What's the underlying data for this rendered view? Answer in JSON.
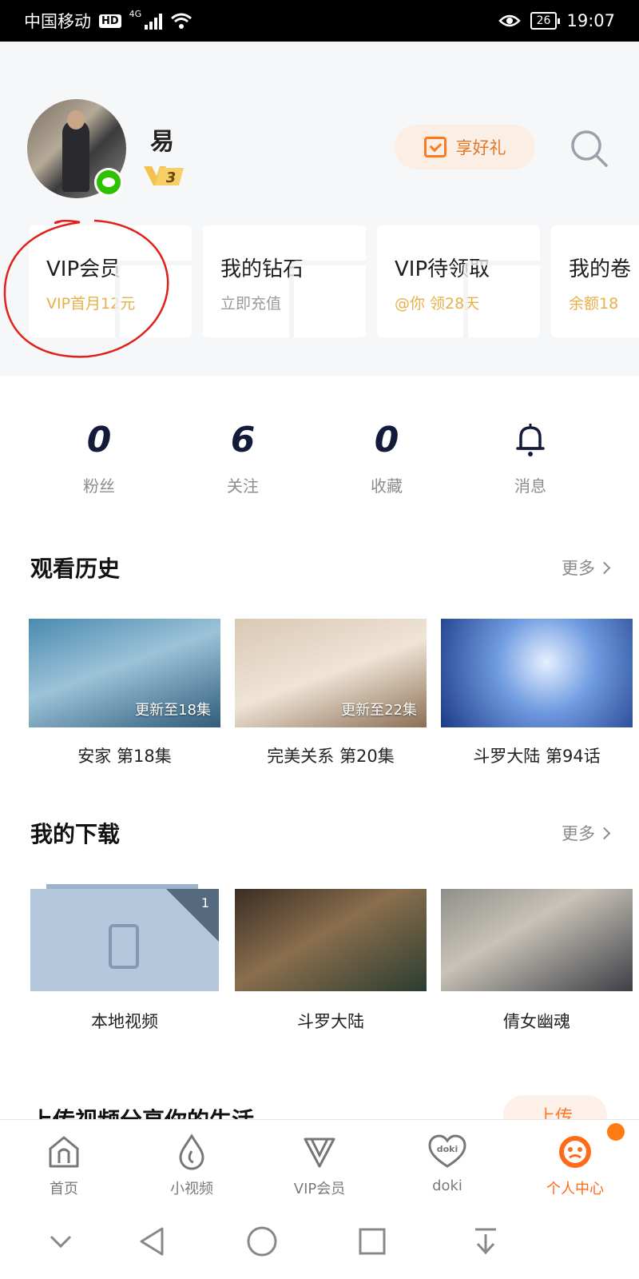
{
  "status_bar": {
    "carrier": "中国移动",
    "hd": "HD",
    "network": "4G",
    "battery": "26",
    "time": "19:07"
  },
  "profile": {
    "username": "易",
    "vip_level": "3",
    "gift_label": "享好礼"
  },
  "cards": [
    {
      "title": "VIP会员",
      "subtitle": "VIP首月12元",
      "subtitle_color": "#e8b04a"
    },
    {
      "title": "我的钻石",
      "subtitle": "立即充值",
      "subtitle_color": "#9a9a9a"
    },
    {
      "title": "VIP待领取",
      "subtitle": "@你 领28天",
      "subtitle_color": "#e8b04a"
    },
    {
      "title": "我的卷",
      "subtitle": "余额18",
      "subtitle_color": "#e8b04a"
    }
  ],
  "stats": [
    {
      "value": "0",
      "label": "粉丝"
    },
    {
      "value": "6",
      "label": "关注"
    },
    {
      "value": "0",
      "label": "收藏"
    },
    {
      "label": "消息",
      "icon": "bell-icon"
    }
  ],
  "history": {
    "title": "观看历史",
    "more": "更多",
    "items": [
      {
        "caption": "安家 第18集",
        "update": "更新至18集"
      },
      {
        "caption": "完美关系 第20集",
        "update": "更新至22集"
      },
      {
        "caption": "斗罗大陆 第94话",
        "update": ""
      }
    ]
  },
  "downloads": {
    "title": "我的下载",
    "more": "更多",
    "items": [
      {
        "caption": "本地视频",
        "count": "1"
      },
      {
        "caption": "斗罗大陆"
      },
      {
        "caption": "倩女幽魂"
      }
    ]
  },
  "promo": {
    "text": "上传视频分享你的生活",
    "button": "上传"
  },
  "bottom_nav": [
    {
      "label": "首页",
      "icon": "home-icon"
    },
    {
      "label": "小视频",
      "icon": "drop-icon"
    },
    {
      "label": "VIP会员",
      "icon": "vip-icon"
    },
    {
      "label": "doki",
      "icon": "doki-heart-icon"
    },
    {
      "label": "个人中心",
      "icon": "profile-face-icon",
      "active": true
    }
  ],
  "colors": {
    "accent": "#ff6a1a",
    "vip_gold": "#e8b04a",
    "stat_number": "#131a3a",
    "annotation_red": "#e0201b"
  }
}
